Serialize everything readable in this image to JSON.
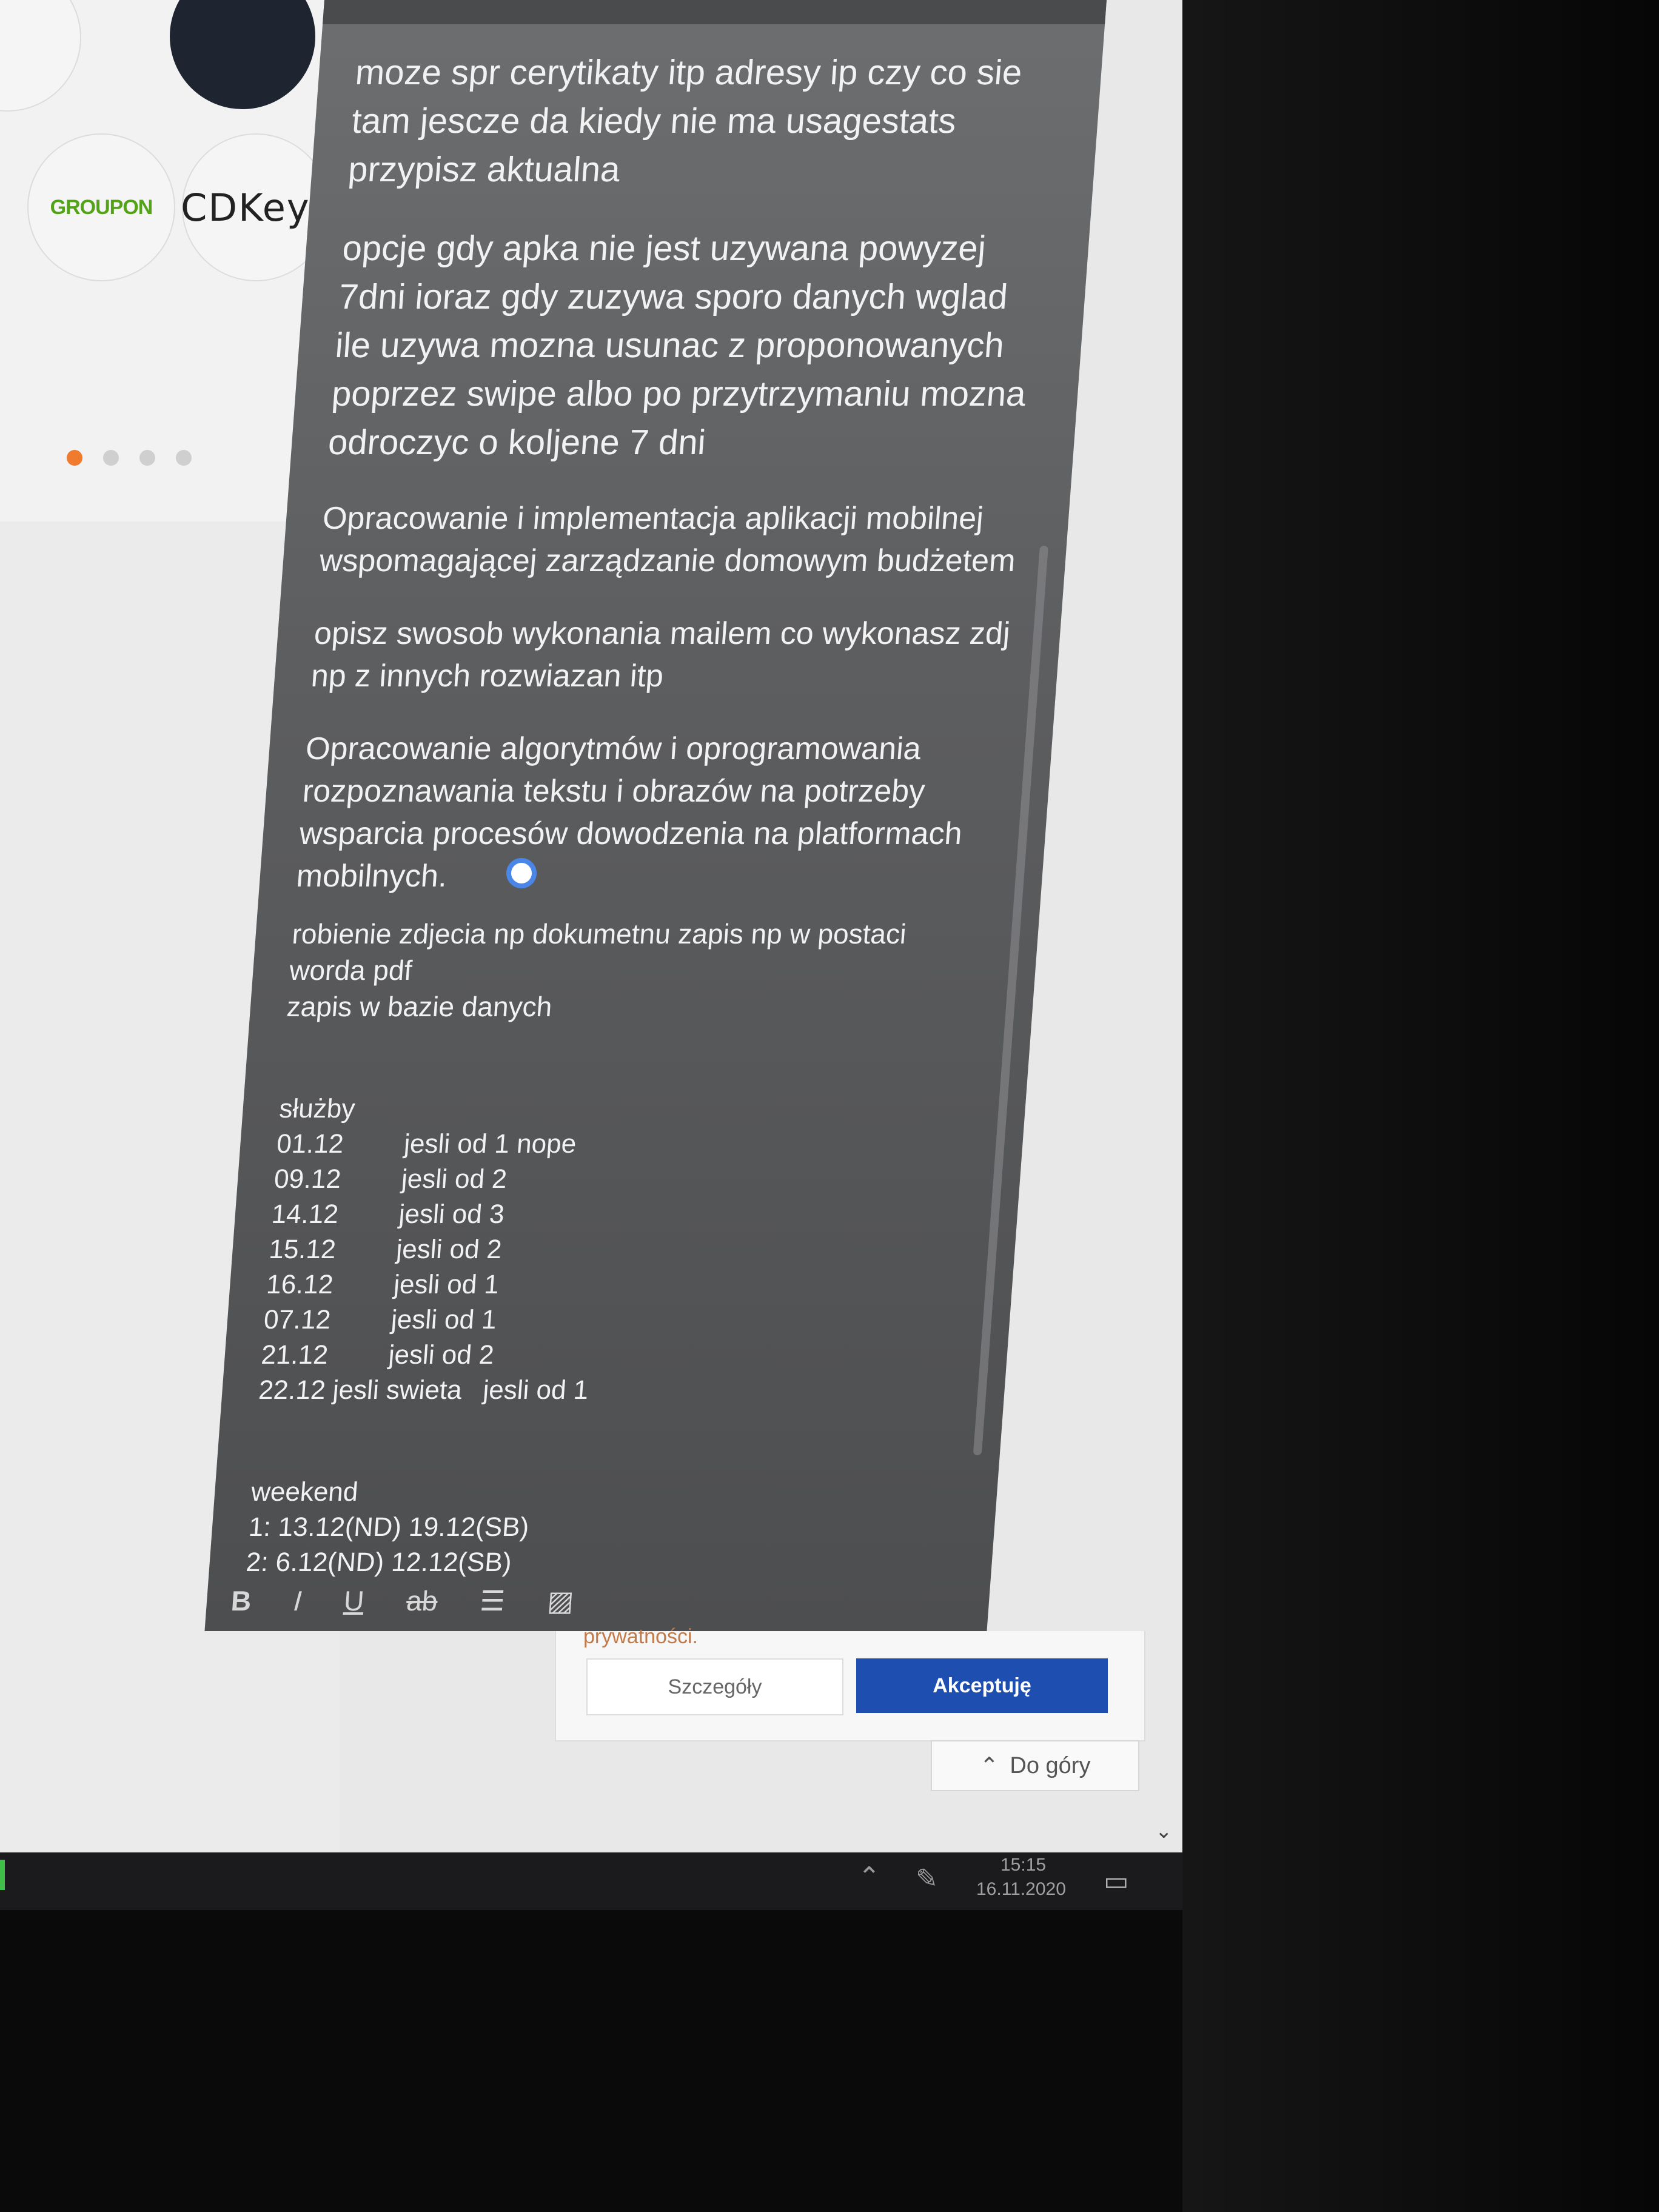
{
  "left_page": {
    "brands": [
      "GROUPON",
      "CDKeys"
    ],
    "carousel_next_icon": "chevron-right"
  },
  "notes": {
    "paragraphs": [
      "moze spr cerytikaty itp adresy ip czy co sie tam jescze da kiedy nie ma usagestats przypisz aktualna",
      "opcje gdy apka nie jest uzywana powyzej 7dni ioraz gdy zuzywa sporo danych wglad ile uzywa mozna usunac z proponowanych poprzez swipe albo po przytrzymaniu mozna odroczyc o koljene 7 dni",
      "Opracowanie i implementacja aplikacji mobilnej wspomagającej zarządzanie domowym budżetem",
      "opisz swosob wykonania mailem co wykonasz zdj np z innych rozwiazan itp",
      "Opracowanie algorytmów i oprogramowania rozpoznawania tekstu i obrazów na potrzeby wsparcia procesów dowodzenia na platformach mobilnych.",
      "robienie zdjecia np dokumetnu zapis np w postaci worda pdf",
      "zapis w bazie danych"
    ],
    "duties_header": "służby",
    "duties": [
      {
        "date": "01.12",
        "note": "jesli od 1 nope"
      },
      {
        "date": "09.12",
        "note": "jesli od 2"
      },
      {
        "date": "14.12",
        "note": "jesli od 3"
      },
      {
        "date": "15.12",
        "note": "jesli od 2"
      },
      {
        "date": "16.12",
        "note": "jesli od 1"
      },
      {
        "date": "07.12",
        "note": "jesli od 1"
      },
      {
        "date": "21.12",
        "note": "jesli od 2"
      },
      {
        "date": "22.12 jesli swieta",
        "note": "jesli od 1"
      }
    ],
    "weekend_header": "weekend",
    "weekend": [
      "1: 13.12(ND) 19.12(SB)",
      "2: 6.12(ND) 12.12(SB)"
    ],
    "toolbar": {
      "bold": "B",
      "italic": "I",
      "underline": "U",
      "strike": "ab"
    }
  },
  "cookie": {
    "link_text": "prywatności.",
    "details_label": "Szczegóły",
    "accept_label": "Akceptuję",
    "accent_color": "#1e4fb0"
  },
  "back_to_top": {
    "label": "Do góry"
  },
  "taskbar": {
    "time": "15:15",
    "date": "16.11.2020"
  }
}
